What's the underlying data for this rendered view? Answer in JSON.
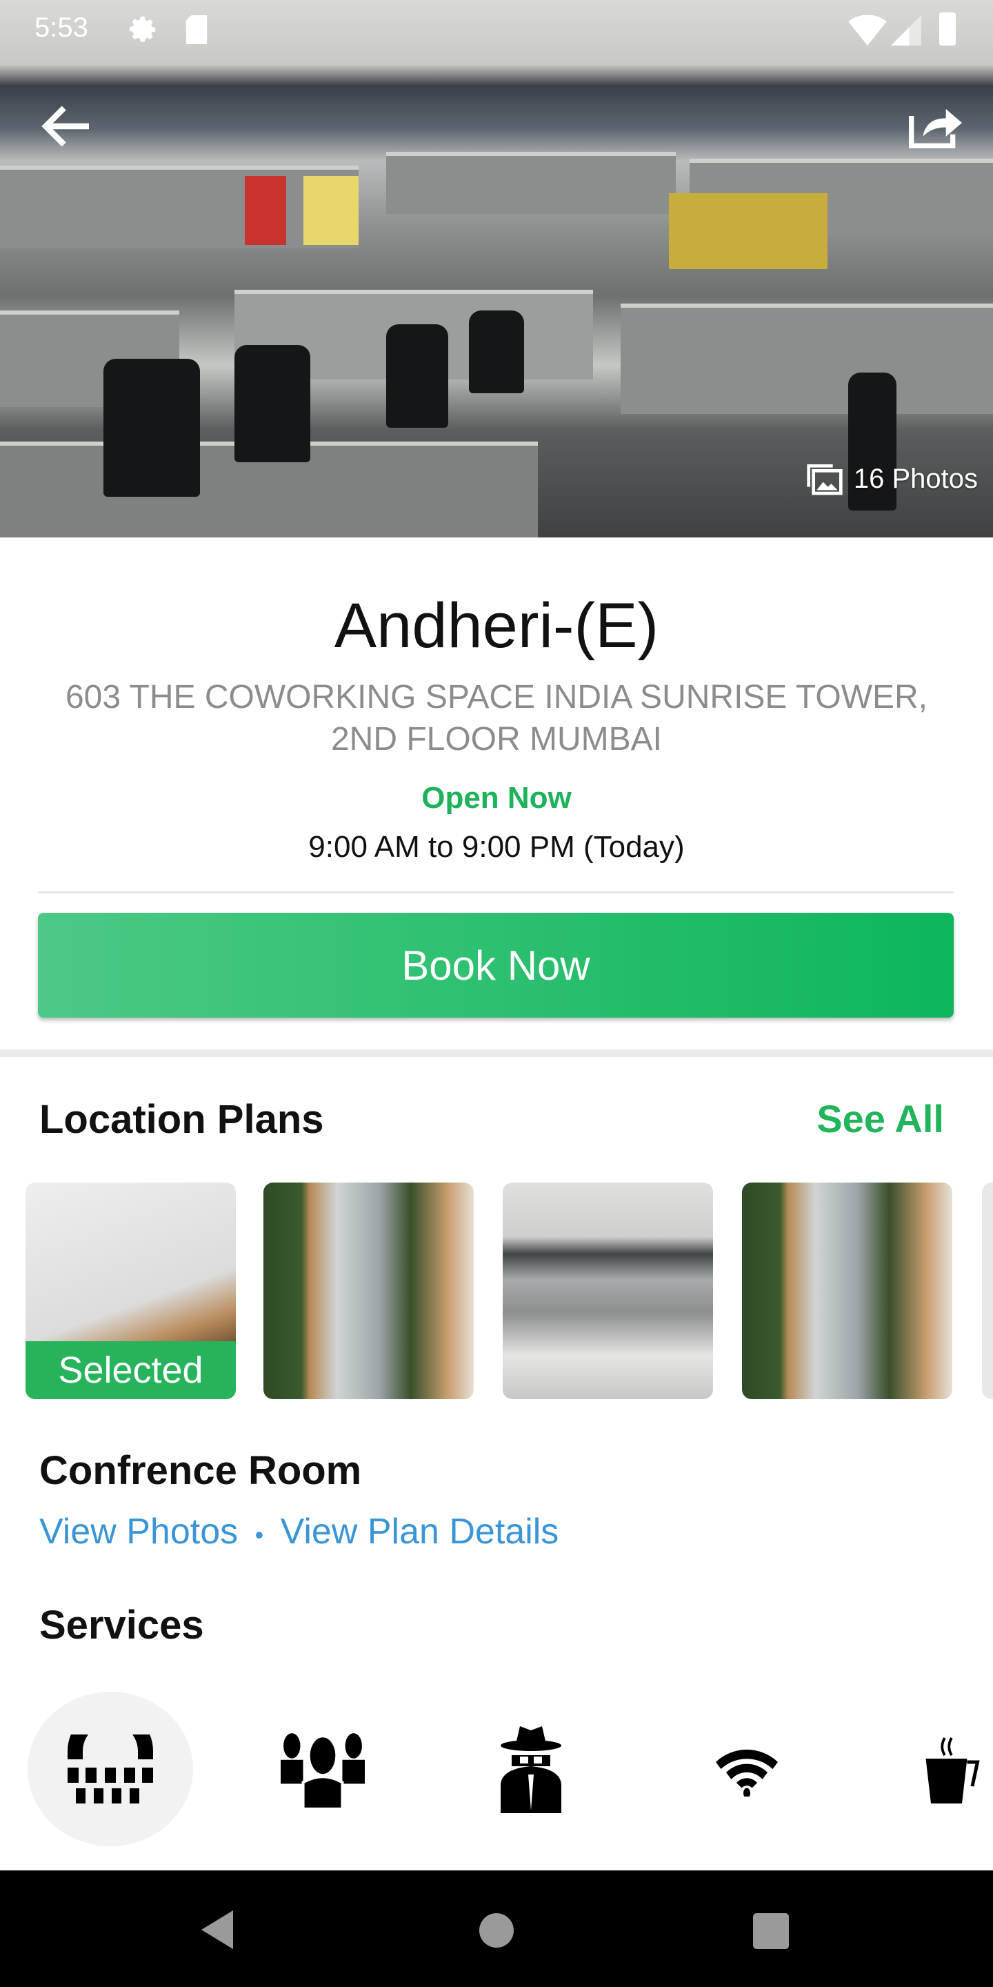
{
  "status_bar": {
    "time": "5:53",
    "icons": [
      "gear-icon",
      "sd-card-icon",
      "wifi-icon",
      "signal-icon",
      "battery-icon"
    ]
  },
  "hero": {
    "photos_count": "16 Photos",
    "icons": [
      "back-arrow-icon",
      "share-icon",
      "photos-icon"
    ]
  },
  "location": {
    "name": "Andheri-(E)",
    "address_line1": "603 THE COWORKING SPACE INDIA SUNRISE TOWER,",
    "address_line2": "2ND FLOOR MUMBAI",
    "status": "Open Now",
    "hours": "9:00 AM to 9:00 PM (Today)"
  },
  "book_label": "Book Now",
  "plans": {
    "title": "Location Plans",
    "see_all": "See All",
    "selected_label": "Selected",
    "thumbnails": [
      "conference-room",
      "lounge",
      "open-desks",
      "lounge",
      "more"
    ]
  },
  "selected_plan": {
    "name": "Confrence Room",
    "view_photos": "View Photos",
    "separator": "•",
    "view_details": "View Plan Details"
  },
  "services": {
    "title": "Services",
    "items": [
      "telephone-icon",
      "group-icon",
      "security-icon",
      "wifi-icon",
      "coffee-icon"
    ]
  },
  "colors": {
    "accent_green": "#1db35b",
    "link_blue": "#3a95d6"
  }
}
